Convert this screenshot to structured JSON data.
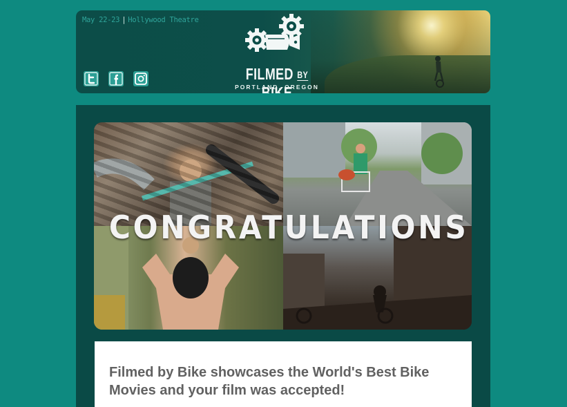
{
  "header": {
    "event_date": "May 22-23",
    "event_separator": "|",
    "event_venue": "Hollywood Theatre",
    "logo": {
      "title_part1": "FILMED",
      "title_by": "BY",
      "title_part2": "BIKE",
      "subtitle": "PORTLAND, OREGON"
    },
    "social": [
      {
        "icon": "twitter-icon"
      },
      {
        "icon": "facebook-icon"
      },
      {
        "icon": "instagram-icon"
      }
    ]
  },
  "hero": {
    "overlay_text": "CONGRATULATIONS"
  },
  "card": {
    "heading": "Filmed by Bike showcases the World's Best Bike Movies and your film was accepted!"
  },
  "colors": {
    "page_bg": "#0e8a80",
    "panel_bg": "#0a4a46",
    "header_bg": "#0c4d48",
    "accent": "#2fa49a",
    "heading_text": "#616161"
  }
}
